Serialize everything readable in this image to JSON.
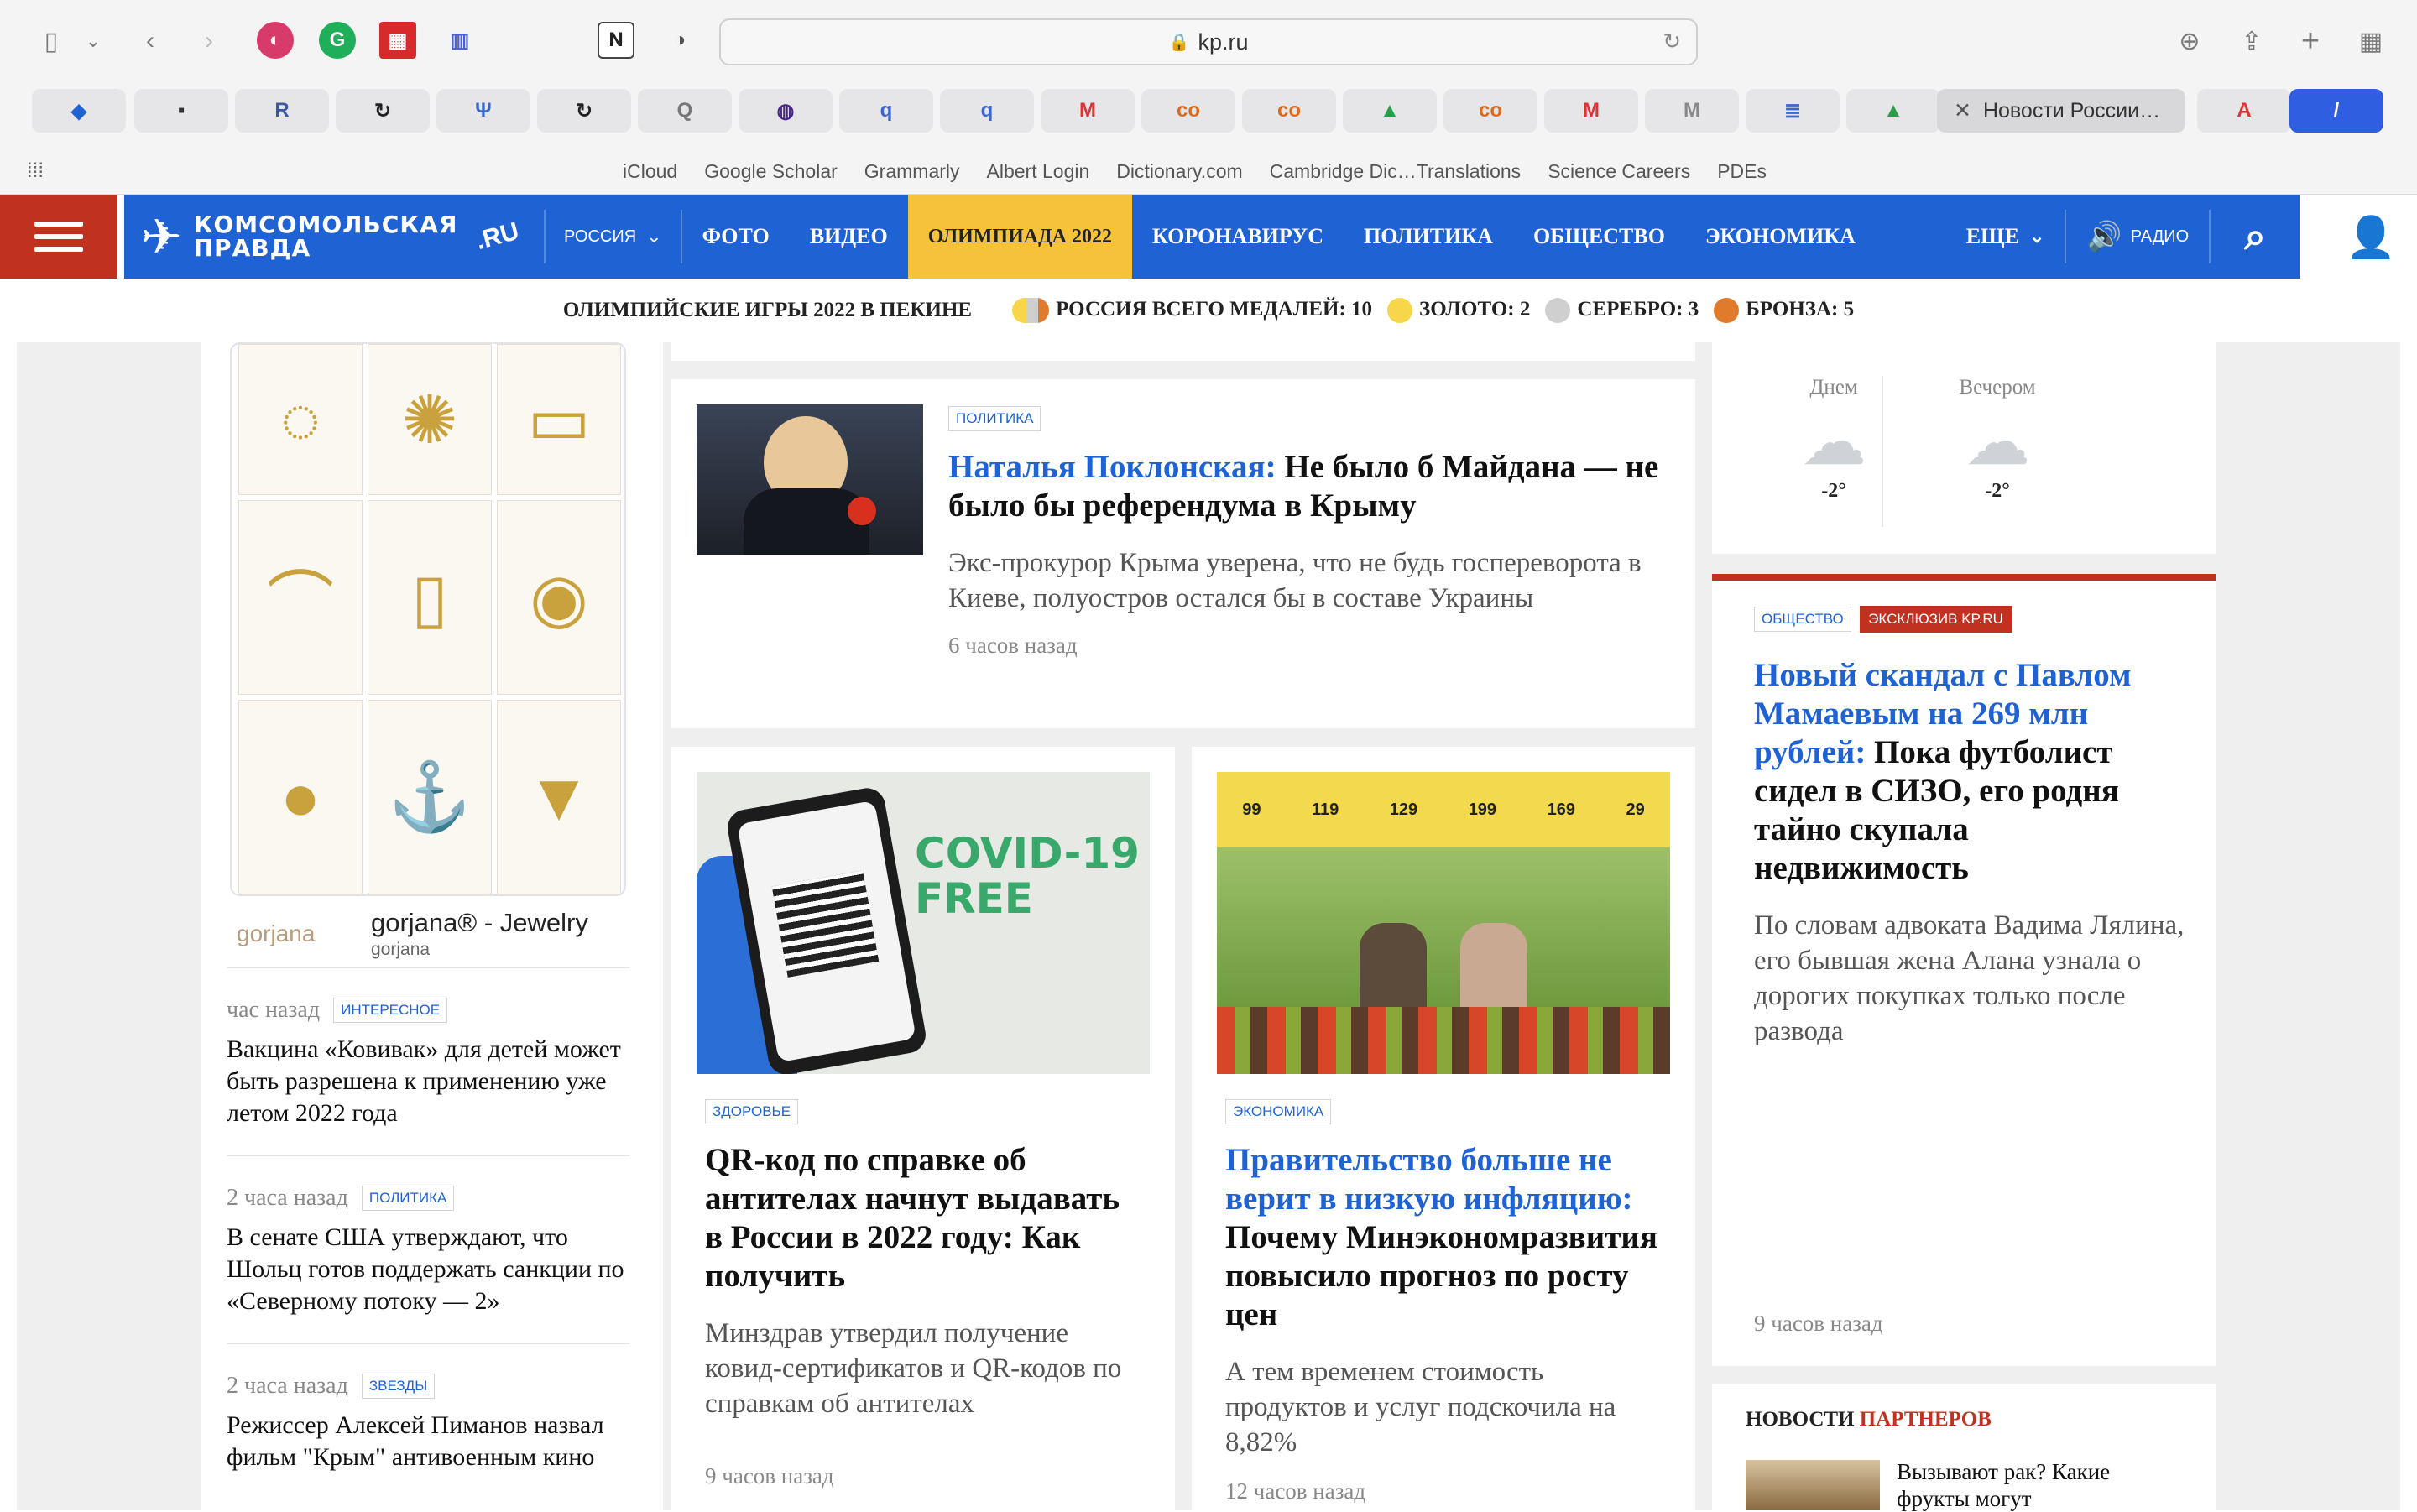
{
  "browser": {
    "url": "kp.ru",
    "active_tab_title": "Новости России…",
    "favorites": [
      "iCloud",
      "Google Scholar",
      "Grammarly",
      "Albert Login",
      "Dictionary.com",
      "Cambridge Dic…Translations",
      "Science Careers",
      "PDEs"
    ]
  },
  "nav": {
    "logo_line1": "КОМСОМОЛЬСКАЯ",
    "logo_line2": "ПРАВДА",
    "logo_ru": ".RU",
    "region": "РОССИЯ",
    "items": [
      "ФОТО",
      "ВИДЕО",
      "ОЛИМПИАДА 2022",
      "КОРОНАВИРУС",
      "ПОЛИТИКА",
      "ОБЩЕСТВО",
      "ЭКОНОМИКА"
    ],
    "more": "ЕЩЕ",
    "radio": "РАДИО"
  },
  "medals": {
    "title": "ОЛИМПИЙСКИЕ ИГРЫ 2022 В ПЕКИНЕ",
    "total": "РОССИЯ ВСЕГО МЕДАЛЕЙ: 10",
    "gold": "ЗОЛОТО: 2",
    "silver": "СЕРЕБРО: 3",
    "bronze": "БРОНЗА: 5",
    "colors": {
      "gold": "#f7d64a",
      "silver": "#cfcfcf",
      "bronze": "#e07b2e"
    }
  },
  "ad": {
    "brand_logo": "gorjana",
    "title": "gorjana® - Jewelry",
    "sub": "gorjana"
  },
  "feed": [
    {
      "time": "час назад",
      "tag": "ИНТЕРЕСНОЕ",
      "title": "Вакцина «Ковивак» для детей может быть разрешена к применению уже летом 2022 года"
    },
    {
      "time": "2 часа назад",
      "tag": "ПОЛИТИКА",
      "title": "В сенате США утверждают, что Шольц готов поддержать санкции по «Северному потоку — 2»"
    },
    {
      "time": "2 часа назад",
      "tag": "ЗВЕЗДЫ",
      "title": "Режиссер Алексей Пиманов назвал фильм \"Крым\" антивоенным кино"
    }
  ],
  "main": {
    "top": {
      "tag": "ПОЛИТИКА",
      "title_blue": "Наталья Поклонская:",
      "title_rest": " Не было б Майдана — не было бы референдума в Крыму",
      "lead": "Экс-прокурор Крыма уверена, что не будь госпереворота в Киеве, полуостров остался бы в составе Украины",
      "time": "6 часов назад"
    },
    "left": {
      "tag": "ЗДОРОВЬЕ",
      "title": "QR-код по справке об антителах начнут выдавать в России в 2022 году: Как получить",
      "lead": "Минздрав утвердил получение ковид-сертификатов и QR-кодов по справкам об антителах",
      "time": "9 часов назад",
      "photo_text": "COVID-19 FREE"
    },
    "right": {
      "tag": "ЭКОНОМИКА",
      "title_blue": "Правительство больше не верит в низкую инфляцию:",
      "title_rest": " Почему Минэкономразвития повысило прогноз по росту цен",
      "lead": "А тем временем стоимость продуктов и услуг подскочила на 8,82%",
      "time": "12 часов назад",
      "prices": [
        "99",
        "119",
        "129",
        "199",
        "169",
        "29"
      ]
    }
  },
  "weather": {
    "labels": [
      "Днем",
      "Вечером"
    ],
    "temps": [
      "-2°",
      "-2°"
    ]
  },
  "exclusive": {
    "tag1": "ОБЩЕСТВО",
    "tag2": "ЭКСКЛЮЗИВ KP.RU",
    "title_blue": "Новый скандал с Павлом Мамаевым на 269 млн рублей:",
    "title_rest": " Пока футболист сидел в СИЗО, его родня тайно скупала недвижимость",
    "lead": "По словам адвоката Вадима Лялина, его бывшая жена Алана узнала о дорогих покупках только после развода",
    "time": "9 часов назад"
  },
  "partners": {
    "head1": "НОВОСТИ",
    "head2": "ПАРТНЕРОВ",
    "item": "Вызывают рак? Какие фрукты могут"
  }
}
